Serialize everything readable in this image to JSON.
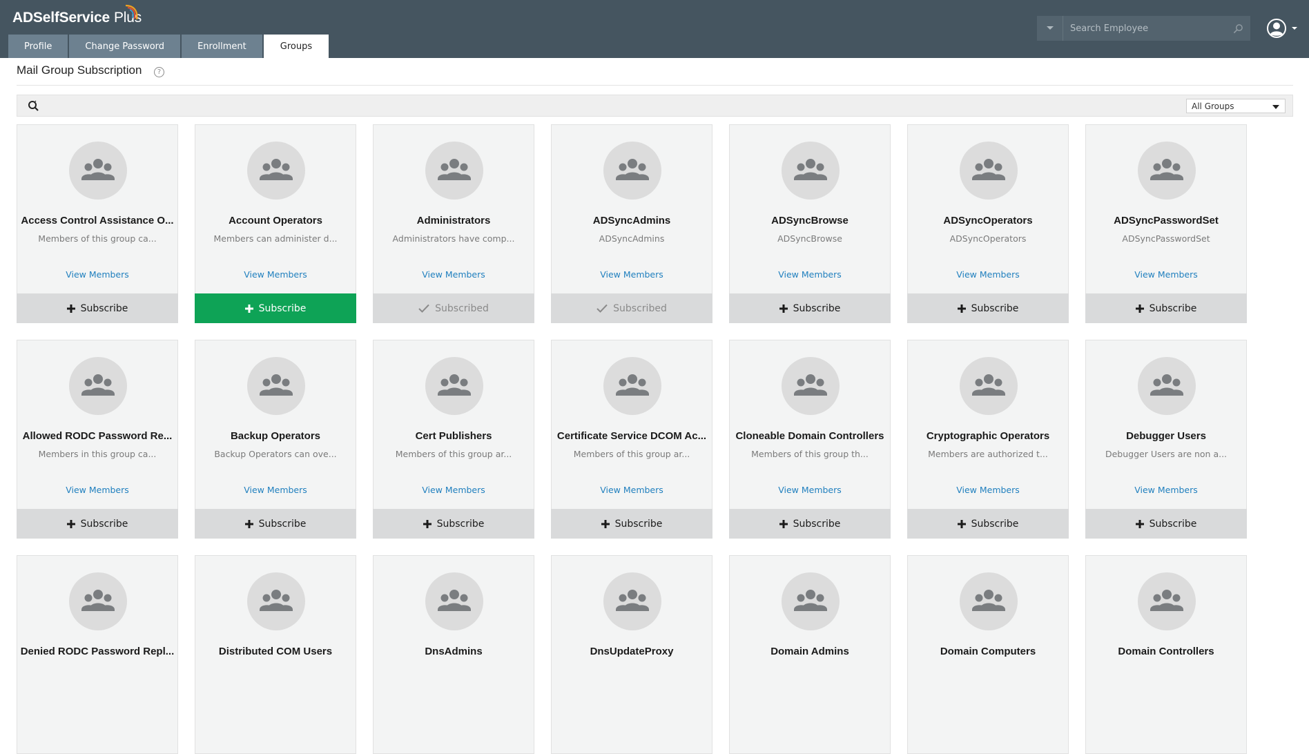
{
  "app": {
    "logo_text": "ADSelfService",
    "logo_plus": "Plus"
  },
  "tabs": [
    {
      "label": "Profile"
    },
    {
      "label": "Change Password"
    },
    {
      "label": "Enrollment"
    },
    {
      "label": "Groups",
      "active": true
    }
  ],
  "search": {
    "placeholder": "Search Employee"
  },
  "page": {
    "title": "Mail Group Subscription",
    "help": "?"
  },
  "filter": {
    "selected": "All Groups"
  },
  "colors": {
    "header_bg": "#455560",
    "tab_bg": "#6d8190",
    "link": "#1f7fbe",
    "subscribe_active": "#0ea356"
  },
  "groups": [
    {
      "name": "Access Control Assistance O...",
      "desc": "Members of this group ca...",
      "link": "View Members",
      "button": "Subscribe",
      "state": "subscribe"
    },
    {
      "name": "Account Operators",
      "desc": "Members can administer d...",
      "link": "View Members",
      "button": "Subscribe",
      "state": "highlight"
    },
    {
      "name": "Administrators",
      "desc": "Administrators have comp...",
      "link": "View Members",
      "button": "Subscribed",
      "state": "subscribed"
    },
    {
      "name": "ADSyncAdmins",
      "desc": "ADSyncAdmins",
      "link": "View Members",
      "button": "Subscribed",
      "state": "subscribed"
    },
    {
      "name": "ADSyncBrowse",
      "desc": "ADSyncBrowse",
      "link": "View Members",
      "button": "Subscribe",
      "state": "subscribe"
    },
    {
      "name": "ADSyncOperators",
      "desc": "ADSyncOperators",
      "link": "View Members",
      "button": "Subscribe",
      "state": "subscribe"
    },
    {
      "name": "ADSyncPasswordSet",
      "desc": "ADSyncPasswordSet",
      "link": "View Members",
      "button": "Subscribe",
      "state": "subscribe"
    },
    {
      "name": "Allowed RODC Password Re...",
      "desc": "Members in this group ca...",
      "link": "View Members",
      "button": "Subscribe",
      "state": "subscribe"
    },
    {
      "name": "Backup Operators",
      "desc": "Backup Operators can ove...",
      "link": "View Members",
      "button": "Subscribe",
      "state": "subscribe"
    },
    {
      "name": "Cert Publishers",
      "desc": "Members of this group ar...",
      "link": "View Members",
      "button": "Subscribe",
      "state": "subscribe"
    },
    {
      "name": "Certificate Service DCOM Ac...",
      "desc": "Members of this group ar...",
      "link": "View Members",
      "button": "Subscribe",
      "state": "subscribe"
    },
    {
      "name": "Cloneable Domain Controllers",
      "desc": "Members of this group th...",
      "link": "View Members",
      "button": "Subscribe",
      "state": "subscribe"
    },
    {
      "name": "Cryptographic Operators",
      "desc": "Members are authorized t...",
      "link": "View Members",
      "button": "Subscribe",
      "state": "subscribe"
    },
    {
      "name": "Debugger Users",
      "desc": "Debugger Users are non a...",
      "link": "View Members",
      "button": "Subscribe",
      "state": "subscribe"
    },
    {
      "name": "Denied RODC Password Repl...",
      "desc": "",
      "link": "",
      "button": "",
      "state": "subscribe"
    },
    {
      "name": "Distributed COM Users",
      "desc": "",
      "link": "",
      "button": "",
      "state": "subscribe"
    },
    {
      "name": "DnsAdmins",
      "desc": "",
      "link": "",
      "button": "",
      "state": "subscribe"
    },
    {
      "name": "DnsUpdateProxy",
      "desc": "",
      "link": "",
      "button": "",
      "state": "subscribe"
    },
    {
      "name": "Domain Admins",
      "desc": "",
      "link": "",
      "button": "",
      "state": "subscribe"
    },
    {
      "name": "Domain Computers",
      "desc": "",
      "link": "",
      "button": "",
      "state": "subscribe"
    },
    {
      "name": "Domain Controllers",
      "desc": "",
      "link": "",
      "button": "",
      "state": "subscribe"
    }
  ]
}
